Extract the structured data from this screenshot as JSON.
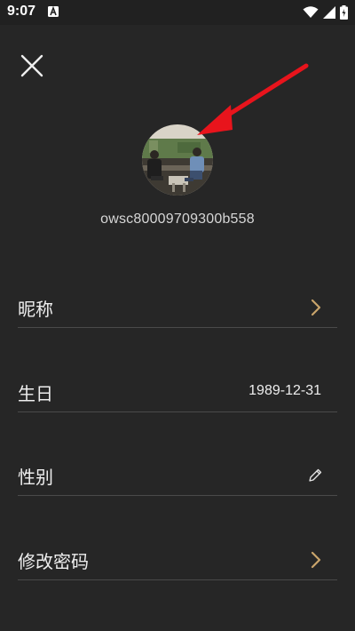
{
  "status_bar": {
    "time": "9:07",
    "notification_icon": "a-letter-icon",
    "right_icons": [
      "wifi-icon",
      "signal-icon",
      "battery-charging-icon"
    ]
  },
  "header": {
    "close_icon": "close-icon"
  },
  "profile": {
    "user_id": "owsc80009709300b558"
  },
  "rows": [
    {
      "label": "昵称",
      "value": "",
      "trailing": "chevron-right-icon"
    },
    {
      "label": "生日",
      "value": "1989-12-31",
      "trailing": ""
    },
    {
      "label": "性别",
      "value": "",
      "trailing": "pencil-icon"
    },
    {
      "label": "修改密码",
      "value": "",
      "trailing": "chevron-right-icon"
    }
  ],
  "colors": {
    "background": "#262626",
    "divider": "#4a4a4a",
    "chevron": "#c9a46b",
    "annotation_arrow": "#e8141c"
  }
}
